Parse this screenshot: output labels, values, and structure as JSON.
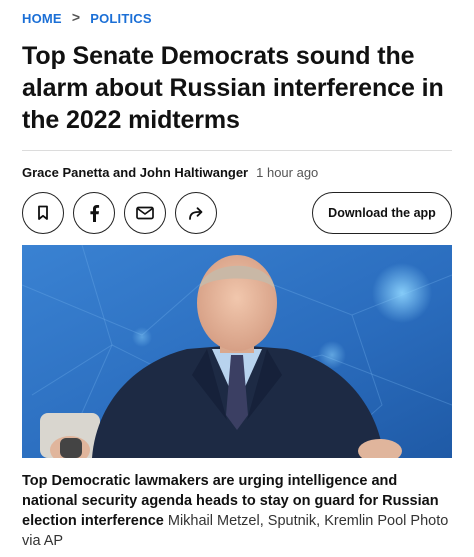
{
  "breadcrumb": {
    "home": "HOME",
    "separator": ">",
    "section": "POLITICS"
  },
  "article": {
    "headline": "Top Senate Democrats sound the alarm about Russian interference in the 2022 midterms",
    "authors": "Grace Panetta and John Haltiwanger",
    "timestamp": "1 hour ago"
  },
  "share": {
    "icons": [
      "bookmark-icon",
      "facebook-icon",
      "email-icon",
      "share-icon"
    ],
    "download_label": "Download the app"
  },
  "image": {
    "caption": "Top Democratic lawmakers are urging intelligence and national security agenda heads to stay on guard for Russian election interference",
    "credit": "Mikhail Metzel, Sputnik, Kremlin Pool Photo via AP"
  },
  "colors": {
    "accent": "#1b6fd6",
    "photo_background": "#2f74c4"
  }
}
